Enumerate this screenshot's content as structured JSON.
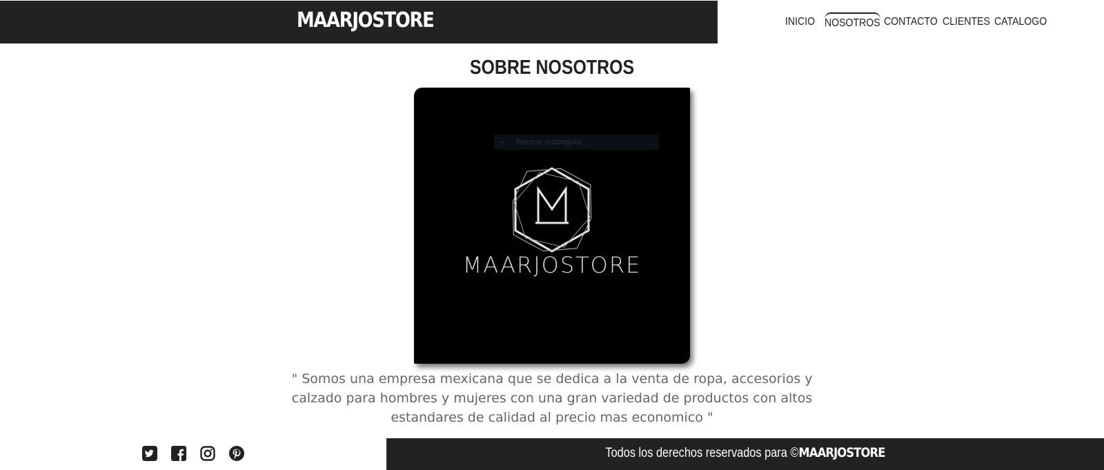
{
  "header": {
    "brand": "MAARJOSTORE",
    "nav": [
      {
        "label": "INICIO"
      },
      {
        "label": "NOSOTROS",
        "active": true
      },
      {
        "label": "CONTACTO"
      },
      {
        "label": "CLIENTES"
      },
      {
        "label": "CATALOGO"
      }
    ]
  },
  "main": {
    "title": "SOBRE NOSOTROS",
    "logo": {
      "overlay_text": "Recorte rectangular",
      "wordmark": "MAARJOSTORE",
      "monogram": "M"
    },
    "description": "\" Somos una empresa mexicana que se dedica a la venta de ropa, accesorios y calzado para hombres y mujeres con una gran variedad de productos con altos estandares de calidad al precio mas economico \""
  },
  "footer": {
    "social_icons": [
      "twitter-icon",
      "facebook-icon",
      "instagram-icon",
      "pinterest-icon"
    ],
    "rights_text": "Todos los derechos reservados para ©",
    "rights_brand": "MAARJOSTORE"
  },
  "colors": {
    "dark_bar": "#222222",
    "text": "#222222",
    "description": "#666666",
    "logo_bg": "#000000"
  }
}
